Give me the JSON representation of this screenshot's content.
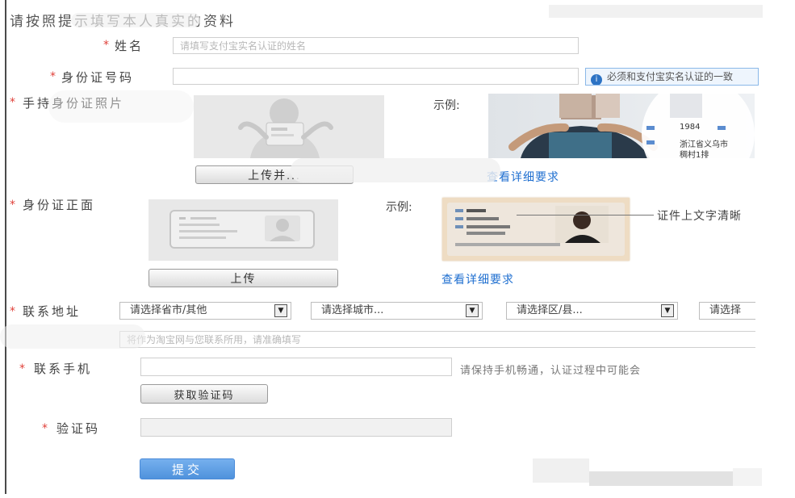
{
  "page": {
    "heading": "请按照提示填写本人真实的资料"
  },
  "form": {
    "required_mark": "*",
    "name": {
      "label": "姓名",
      "placeholder": "请填写支付宝实名认证的姓名"
    },
    "id_number": {
      "label": "身份证号码",
      "placeholder": "",
      "tip": "必须和支付宝实名认证的一致"
    },
    "handheld_photo": {
      "label": "手持身份证照片",
      "example_label": "示例:",
      "upload_label": "上传并...",
      "detail_link": "查看详细要求",
      "example_birth": "1984",
      "example_addr": "浙江省义乌市",
      "example_addr2": "稠村1排"
    },
    "id_front": {
      "label": "身份证正面",
      "example_label": "示例:",
      "upload_label": "上传",
      "detail_link": "查看详细要求",
      "callout": "证件上文字清晰"
    },
    "address": {
      "label": "联系地址",
      "province": "请选择省市/其他",
      "city": "请选择城市...",
      "district": "请选择区/县...",
      "street": "请选择",
      "detail_placeholder": "将作为淘宝网与您联系所用，请准确填写"
    },
    "phone": {
      "label": "联系手机",
      "tip": "请保持手机畅通，认证过程中可能会",
      "get_code_label": "获取验证码"
    },
    "code": {
      "label": "验证码"
    },
    "submit_label": "提交"
  },
  "colors": {
    "required": "#e0413a",
    "link": "#1f6fd0",
    "submit": "#5b9ee6",
    "tip_icon": "#2d73c4"
  }
}
